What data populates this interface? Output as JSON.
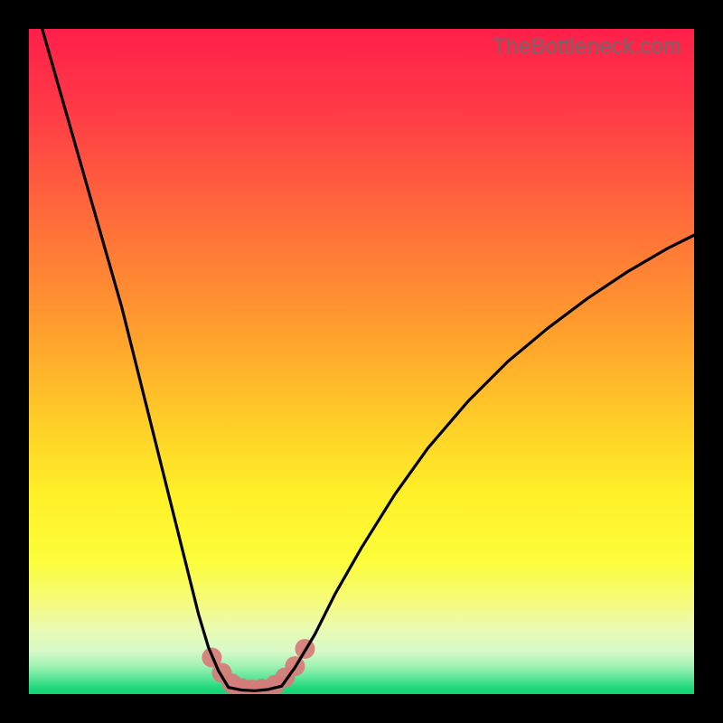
{
  "watermark": "TheBottleneck.com",
  "colors": {
    "frame": "#000000",
    "curve": "#000000",
    "marker_fill": "#d87a7a",
    "gradient_stops": [
      {
        "offset": 0.0,
        "color": "#ff1f4a"
      },
      {
        "offset": 0.12,
        "color": "#ff3a46"
      },
      {
        "offset": 0.28,
        "color": "#ff6a3a"
      },
      {
        "offset": 0.44,
        "color": "#ff9a2e"
      },
      {
        "offset": 0.58,
        "color": "#ffca28"
      },
      {
        "offset": 0.7,
        "color": "#fff028"
      },
      {
        "offset": 0.8,
        "color": "#fcfd3a"
      },
      {
        "offset": 0.86,
        "color": "#f5fb7a"
      },
      {
        "offset": 0.9,
        "color": "#eafbb0"
      },
      {
        "offset": 0.935,
        "color": "#d8f9c8"
      },
      {
        "offset": 0.958,
        "color": "#9ff2b2"
      },
      {
        "offset": 0.975,
        "color": "#5fe69a"
      },
      {
        "offset": 0.99,
        "color": "#22d97f"
      },
      {
        "offset": 1.0,
        "color": "#12d374"
      }
    ]
  },
  "chart_data": {
    "type": "line",
    "title": "",
    "xlabel": "",
    "ylabel": "",
    "xlim": [
      0,
      100
    ],
    "ylim": [
      0,
      100
    ],
    "series": [
      {
        "name": "left-branch",
        "x": [
          2,
          4,
          6,
          8,
          10,
          12,
          14,
          16,
          18,
          20,
          22,
          24,
          25.5,
          27,
          28.5,
          30
        ],
        "y": [
          100,
          93,
          86,
          79,
          72,
          65,
          58,
          50,
          42,
          34,
          26,
          18,
          12,
          7,
          3.5,
          1
        ]
      },
      {
        "name": "valley-floor",
        "x": [
          30,
          32,
          34,
          36,
          38
        ],
        "y": [
          1,
          0.6,
          0.5,
          0.7,
          1.2
        ]
      },
      {
        "name": "right-branch",
        "x": [
          38,
          40,
          43,
          46,
          50,
          55,
          60,
          66,
          72,
          78,
          84,
          90,
          96,
          100
        ],
        "y": [
          1.2,
          4,
          9,
          15,
          22,
          30,
          37,
          44,
          50,
          55,
          59.5,
          63.5,
          67,
          69
        ]
      }
    ],
    "markers": {
      "name": "valley-markers",
      "x": [
        27.5,
        29,
        30.5,
        32,
        33.5,
        35,
        37,
        38.5,
        40,
        41.5
      ],
      "y": [
        5.5,
        3.2,
        1.6,
        0.9,
        0.7,
        0.8,
        1.4,
        2.5,
        4.2,
        6.8
      ]
    }
  }
}
